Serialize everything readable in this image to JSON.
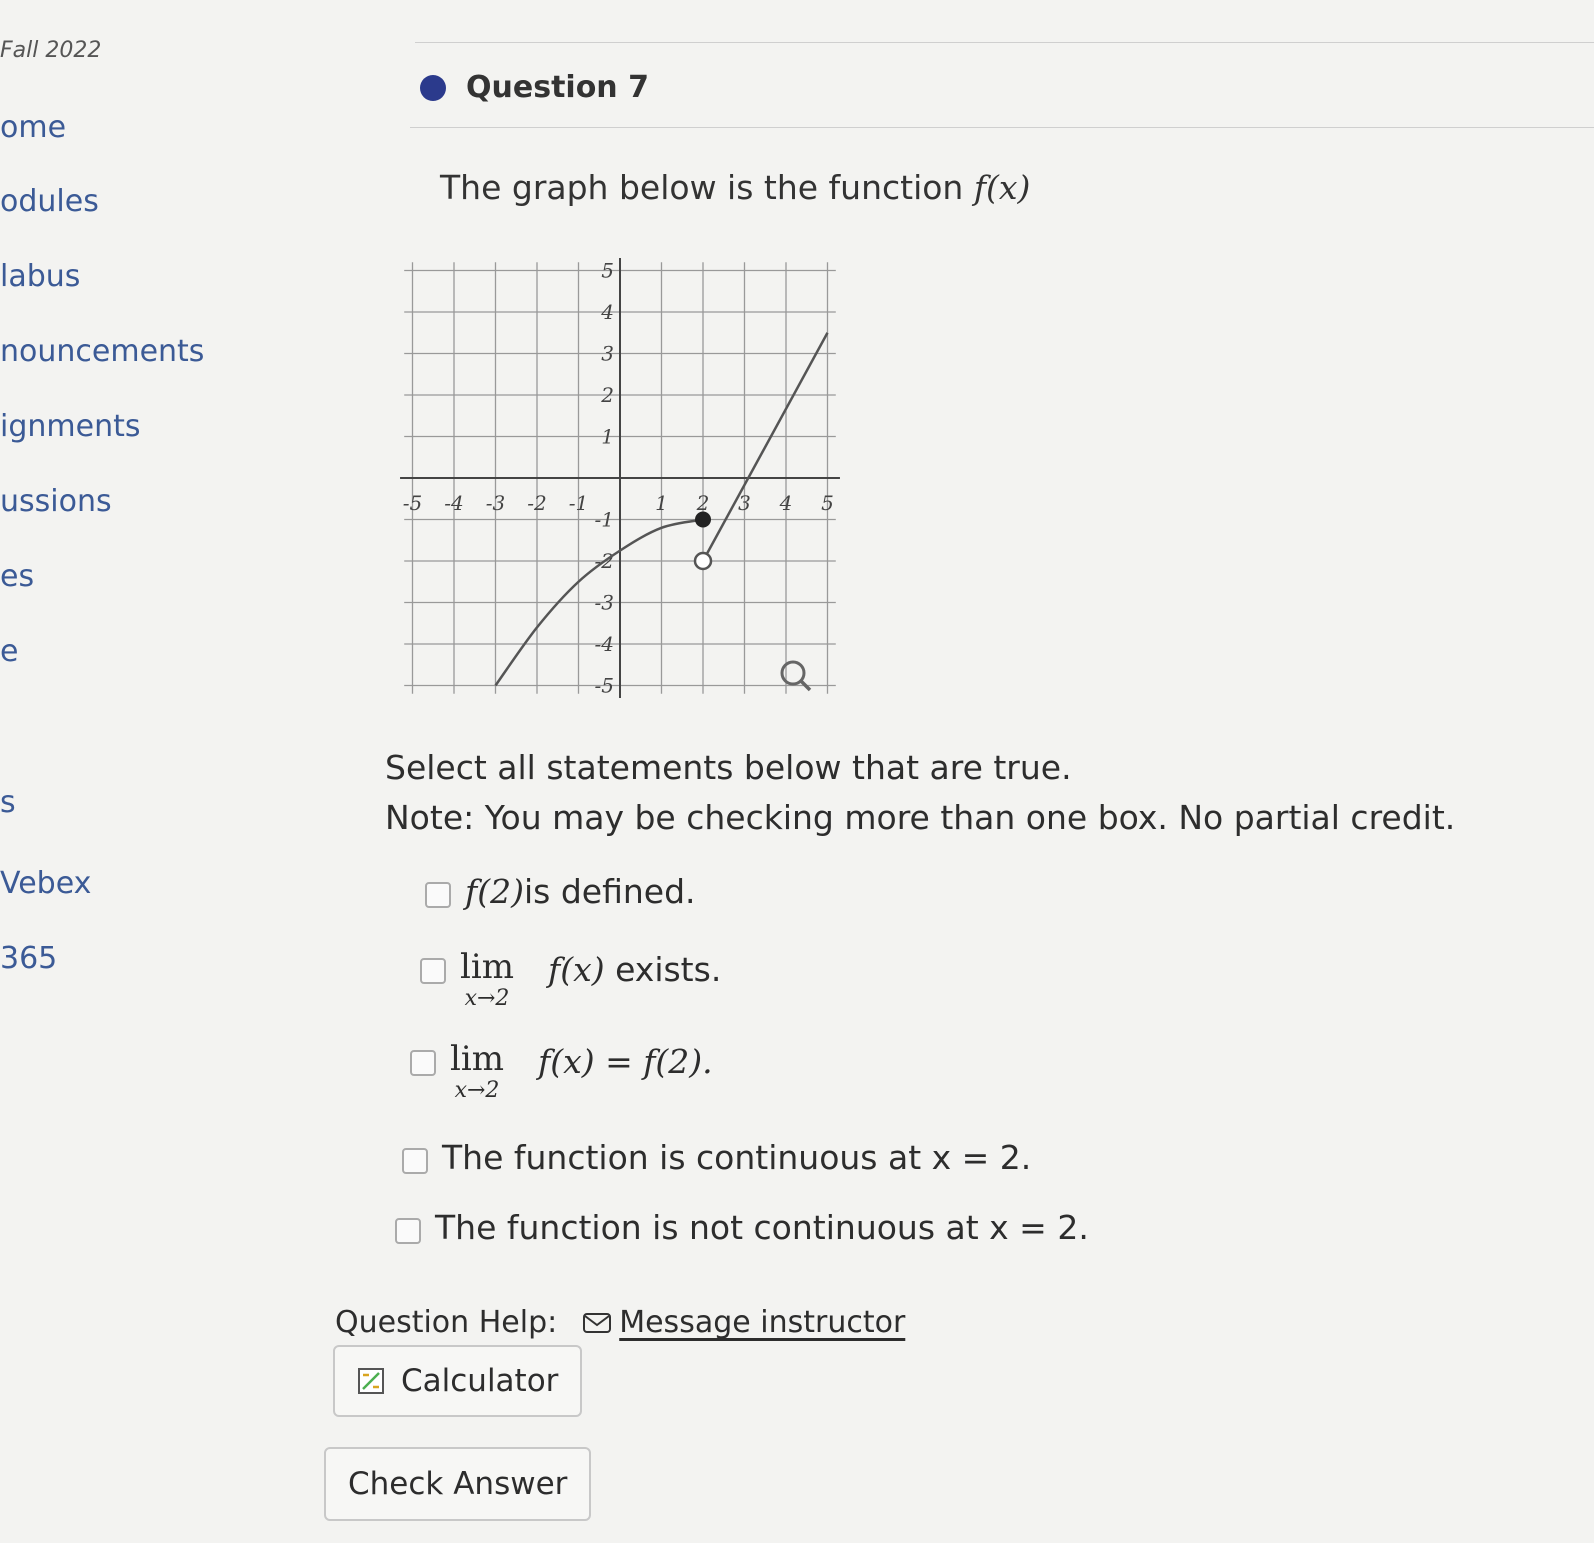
{
  "sidebar": {
    "term": "Fall 2022",
    "items": [
      {
        "label": "ome"
      },
      {
        "label": "odules"
      },
      {
        "label": "labus"
      },
      {
        "label": "nouncements"
      },
      {
        "label": "ignments"
      },
      {
        "label": "ussions"
      },
      {
        "label": "es"
      },
      {
        "label": "e"
      },
      {
        "label": "s"
      },
      {
        "label": "Vebex"
      },
      {
        "label": "365"
      }
    ]
  },
  "question": {
    "title": "Question 7",
    "prompt_text": "The graph below is the function ",
    "prompt_func": "f(x)"
  },
  "graph": {
    "x_ticks": [
      "-5",
      "-4",
      "-3",
      "-2",
      "-1",
      "1",
      "2",
      "3",
      "4",
      "5"
    ],
    "y_ticks": [
      "5",
      "4",
      "3",
      "2",
      "1",
      "-1",
      "-2",
      "-3",
      "-4",
      "-5"
    ],
    "closed_point": {
      "x": 2,
      "y": -1
    },
    "open_point": {
      "x": 2,
      "y": -2
    },
    "curve_left": [
      [
        -3,
        -5
      ],
      [
        -2,
        -3.6
      ],
      [
        -1,
        -2.5
      ],
      [
        0,
        -1.75
      ],
      [
        1,
        -1.2
      ],
      [
        2,
        -1
      ]
    ],
    "line_right": [
      [
        2,
        -2
      ],
      [
        5,
        3.5
      ]
    ],
    "zoom_icon": "magnifier-icon"
  },
  "instructions": {
    "line1": "Select all statements below that are true.",
    "line2": "Note: You may be checking more than one box. No partial credit."
  },
  "options": {
    "o1": {
      "func": "f(2)",
      "text": " is defined."
    },
    "o2": {
      "lim": "lim",
      "sub": "x→2",
      "func": "f(x)",
      "text": " exists."
    },
    "o3": {
      "lim": "lim",
      "sub": "x→2",
      "expr": "f(x) = f(2)."
    },
    "o4": {
      "text": "The function is continuous at x = 2."
    },
    "o5": {
      "text": "The function is not continuous at x = 2."
    }
  },
  "help": {
    "label": "Question Help:",
    "message_link": "Message instructor",
    "calculator": "Calculator",
    "icons": {
      "message": "mail-icon",
      "calculator": "calculator-icon"
    }
  },
  "check_answer": "Check Answer"
}
